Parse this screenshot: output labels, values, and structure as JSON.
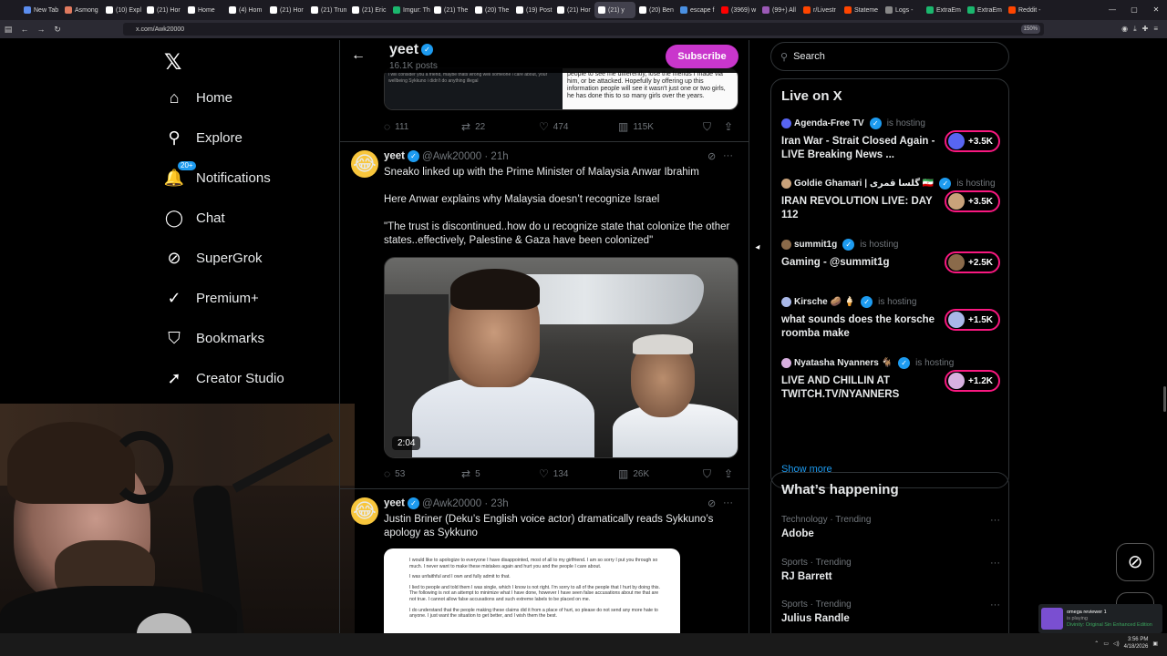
{
  "browser": {
    "tabs": [
      {
        "label": "New Tab",
        "color": "#5b8def"
      },
      {
        "label": "Asmong",
        "color": "#e07a5f"
      },
      {
        "label": "(10) Expl",
        "color": "#ffffff"
      },
      {
        "label": "(21) Hor",
        "color": "#ffffff"
      },
      {
        "label": "Home",
        "color": "#ffffff"
      },
      {
        "label": "(4) Hom",
        "color": "#ffffff"
      },
      {
        "label": "(21) Hor",
        "color": "#ffffff"
      },
      {
        "label": "(21) Trun",
        "color": "#ffffff"
      },
      {
        "label": "(21) Eric",
        "color": "#ffffff"
      },
      {
        "label": "Imgur: Th",
        "color": "#1bb76e"
      },
      {
        "label": "(21) The",
        "color": "#ffffff"
      },
      {
        "label": "(20) The",
        "color": "#ffffff"
      },
      {
        "label": "(19) Post",
        "color": "#ffffff"
      },
      {
        "label": "(21) Hor",
        "color": "#ffffff"
      },
      {
        "label": "(21) y",
        "color": "#ffffff"
      },
      {
        "label": "(20) Ben",
        "color": "#ffffff"
      },
      {
        "label": "escape f",
        "color": "#4a90e2"
      },
      {
        "label": "(3969) w",
        "color": "#ff0000"
      },
      {
        "label": "(99+) All",
        "color": "#9b59b6"
      },
      {
        "label": "r/Livestr",
        "color": "#ff4500"
      },
      {
        "label": "Stateme",
        "color": "#ff4500"
      },
      {
        "label": "Logs - ",
        "color": "#888888"
      },
      {
        "label": "ExtraEm",
        "color": "#1bb76e"
      },
      {
        "label": "ExtraEm",
        "color": "#1bb76e"
      },
      {
        "label": "Reddit -",
        "color": "#ff4500"
      }
    ],
    "active_tab_index": 14,
    "url": "x.com/Awk20000",
    "zoom": "150%"
  },
  "sidebar": {
    "items": [
      {
        "label": "Home",
        "icon": "home-icon",
        "glyph": "⌂"
      },
      {
        "label": "Explore",
        "icon": "search-icon",
        "glyph": "⚲"
      },
      {
        "label": "Notifications",
        "icon": "bell-icon",
        "glyph": "🔔",
        "badge": "20+"
      },
      {
        "label": "Chat",
        "icon": "chat-icon",
        "glyph": "◯"
      },
      {
        "label": "SuperGrok",
        "icon": "grok-icon",
        "glyph": "⊘"
      },
      {
        "label": "Premium+",
        "icon": "verified-icon",
        "glyph": "✓"
      },
      {
        "label": "Bookmarks",
        "icon": "bookmark-icon",
        "glyph": "⛉"
      },
      {
        "label": "Creator Studio",
        "icon": "rocket-icon",
        "glyph": "➚"
      }
    ]
  },
  "profile_header": {
    "name": "yeet",
    "posts": "16.1K posts",
    "subscribe_label": "Subscribe"
  },
  "prev_tweet": {
    "media_left": "i will consider you a friend, maybe thats wrong well someone i care about, your wellbeing\nSykkuno\ni didn't do anything illegal",
    "media_right": "people to see me differently, lose the friends I made via him, or be attacked. Hopefully by offering up this information people will see it wasn't just one or two girls, he has done this to so many girls over the years.",
    "replies": "111",
    "reposts": "22",
    "likes": "474",
    "views": "115K"
  },
  "tweet1": {
    "name": "yeet",
    "handle": "@Awk20000 · 21h",
    "line1": "Sneako linked up with the Prime Minister of Malaysia Anwar Ibrahim",
    "line2": "Here Anwar explains why Malaysia doesn’t recognize Israel",
    "line3": "\"The trust is discontinued..how do u recognize state that colonize the other states..effectively, Palestine & Gaza have been colonized\"",
    "video_duration": "2:04",
    "replies": "53",
    "reposts": "5",
    "likes": "134",
    "views": "26K"
  },
  "tweet2": {
    "name": "yeet",
    "handle": "@Awk20000 · 23h",
    "text": "Justin Briner (Deku’s English voice actor) dramatically reads Sykkuno’s apology as Sykkuno",
    "doc_p1": "I would like to apologize to everyone I have disappointed, most of all to my girlfriend. I am so sorry I put you through so much. I never want to make these mistakes again and hurt you and the people I care about.",
    "doc_p2": "I was unfaithful and I own and fully admit to that.",
    "doc_p3": "I lied to people and told them I was single, which I know is not right. I'm sorry to all of the people that I hurt by doing this. The following is not an attempt to minimize what I have done, however I have seen false accusations about me that are not true. I cannot allow false accusations and such extreme labels to be placed on me.",
    "doc_p4": "I do understand that the people making these claims did it from a place of hurt, so please do not send any more hate to anyone. I just want the situation to get better, and I wish them the best."
  },
  "search": {
    "placeholder": "Search"
  },
  "live": {
    "title": "Live on X",
    "items": [
      {
        "host": "Agenda-Free TV",
        "status": "is hosting",
        "title": "Iran War - Strait Closed Again - LIVE Breaking News ...",
        "count": "+3.5K",
        "avatar_color": "#5865f2"
      },
      {
        "host": "Goldie Ghamari | گلسا قمری 🇮🇷",
        "status": "is hosting",
        "title": "IRAN REVOLUTION LIVE: DAY 112",
        "count": "+3.5K",
        "avatar_color": "#c9a27a"
      },
      {
        "host": "summit1g",
        "status": "is hosting",
        "title": "Gaming - @summit1g",
        "count": "+2.5K",
        "avatar_color": "#8a6a4a"
      },
      {
        "host": "Kirsche 🥔 🍦",
        "status": "is hosting",
        "title": "what sounds does the korsche roomba make",
        "count": "+1.5K",
        "avatar_color": "#a9b8e8"
      },
      {
        "host": "Nyatasha Nyanners 🐐",
        "status": "is hosting",
        "title": "LIVE AND CHILLIN AT TWITCH.TV/NYANNERS",
        "count": "+1.2K",
        "avatar_color": "#d8b0e0"
      }
    ],
    "show_more": "Show more"
  },
  "happening": {
    "title": "What’s happening",
    "trends": [
      {
        "category": "Technology · Trending",
        "name": "Adobe"
      },
      {
        "category": "Sports · Trending",
        "name": "RJ Barrett"
      },
      {
        "category": "Sports · Trending",
        "name": "Julius Randle"
      }
    ]
  },
  "toast": {
    "line1": "omega reviewer 1",
    "line2": "is playing",
    "line3": "Divinity: Original Sin Enhanced Edition"
  },
  "taskbar": {
    "time": "3:56 PM",
    "date": "4/18/2026"
  }
}
